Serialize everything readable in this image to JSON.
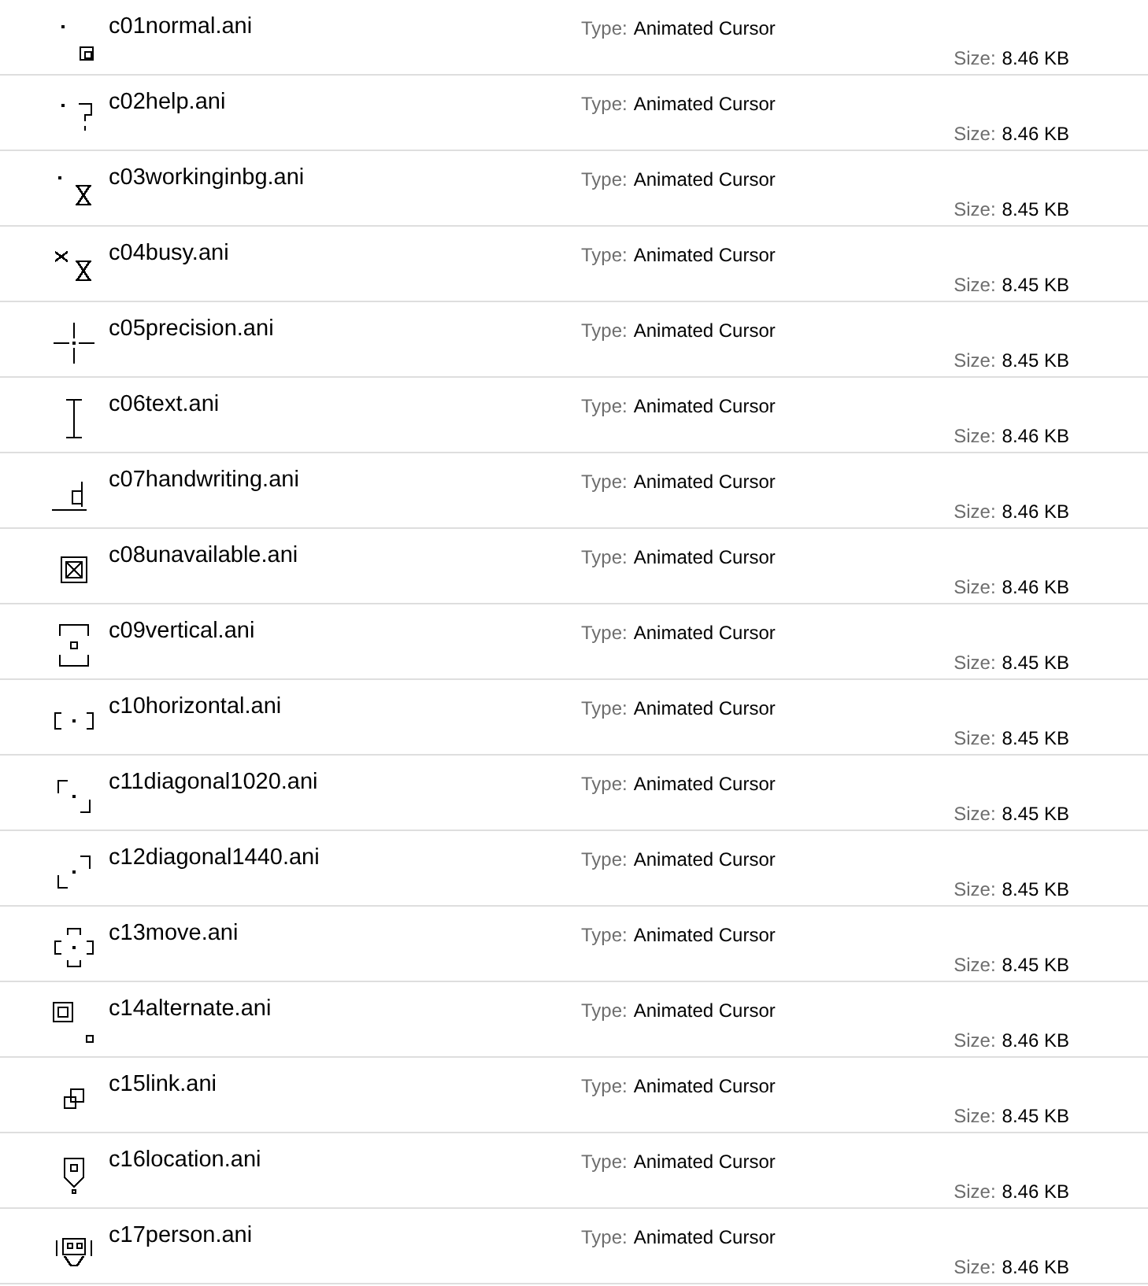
{
  "files": [
    {
      "kind": "arrow",
      "name": "c01normal.ani",
      "type_label": "Type:",
      "type": "Animated Cursor",
      "size_label": "Size:",
      "size": "8.46 KB"
    },
    {
      "kind": "help",
      "name": "c02help.ani",
      "type_label": "Type:",
      "type": "Animated Cursor",
      "size_label": "Size:",
      "size": "8.46 KB"
    },
    {
      "kind": "working",
      "name": "c03workinginbg.ani",
      "type_label": "Type:",
      "type": "Animated Cursor",
      "size_label": "Size:",
      "size": "8.45 KB"
    },
    {
      "kind": "busy",
      "name": "c04busy.ani",
      "type_label": "Type:",
      "type": "Animated Cursor",
      "size_label": "Size:",
      "size": "8.45 KB"
    },
    {
      "kind": "precision",
      "name": "c05precision.ani",
      "type_label": "Type:",
      "type": "Animated Cursor",
      "size_label": "Size:",
      "size": "8.45 KB"
    },
    {
      "kind": "text",
      "name": "c06text.ani",
      "type_label": "Type:",
      "type": "Animated Cursor",
      "size_label": "Size:",
      "size": "8.46 KB"
    },
    {
      "kind": "handwriting",
      "name": "c07handwriting.ani",
      "type_label": "Type:",
      "type": "Animated Cursor",
      "size_label": "Size:",
      "size": "8.46 KB"
    },
    {
      "kind": "unavailable",
      "name": "c08unavailable.ani",
      "type_label": "Type:",
      "type": "Animated Cursor",
      "size_label": "Size:",
      "size": "8.46 KB"
    },
    {
      "kind": "vertical",
      "name": "c09vertical.ani",
      "type_label": "Type:",
      "type": "Animated Cursor",
      "size_label": "Size:",
      "size": "8.45 KB"
    },
    {
      "kind": "horizontal",
      "name": "c10horizontal.ani",
      "type_label": "Type:",
      "type": "Animated Cursor",
      "size_label": "Size:",
      "size": "8.45 KB"
    },
    {
      "kind": "diagonal1",
      "name": "c11diagonal1020.ani",
      "type_label": "Type:",
      "type": "Animated Cursor",
      "size_label": "Size:",
      "size": "8.45 KB"
    },
    {
      "kind": "diagonal2",
      "name": "c12diagonal1440.ani",
      "type_label": "Type:",
      "type": "Animated Cursor",
      "size_label": "Size:",
      "size": "8.45 KB"
    },
    {
      "kind": "move",
      "name": "c13move.ani",
      "type_label": "Type:",
      "type": "Animated Cursor",
      "size_label": "Size:",
      "size": "8.45 KB"
    },
    {
      "kind": "alternate",
      "name": "c14alternate.ani",
      "type_label": "Type:",
      "type": "Animated Cursor",
      "size_label": "Size:",
      "size": "8.46 KB"
    },
    {
      "kind": "link",
      "name": "c15link.ani",
      "type_label": "Type:",
      "type": "Animated Cursor",
      "size_label": "Size:",
      "size": "8.45 KB"
    },
    {
      "kind": "location",
      "name": "c16location.ani",
      "type_label": "Type:",
      "type": "Animated Cursor",
      "size_label": "Size:",
      "size": "8.46 KB"
    },
    {
      "kind": "person",
      "name": "c17person.ani",
      "type_label": "Type:",
      "type": "Animated Cursor",
      "size_label": "Size:",
      "size": "8.46 KB"
    }
  ]
}
